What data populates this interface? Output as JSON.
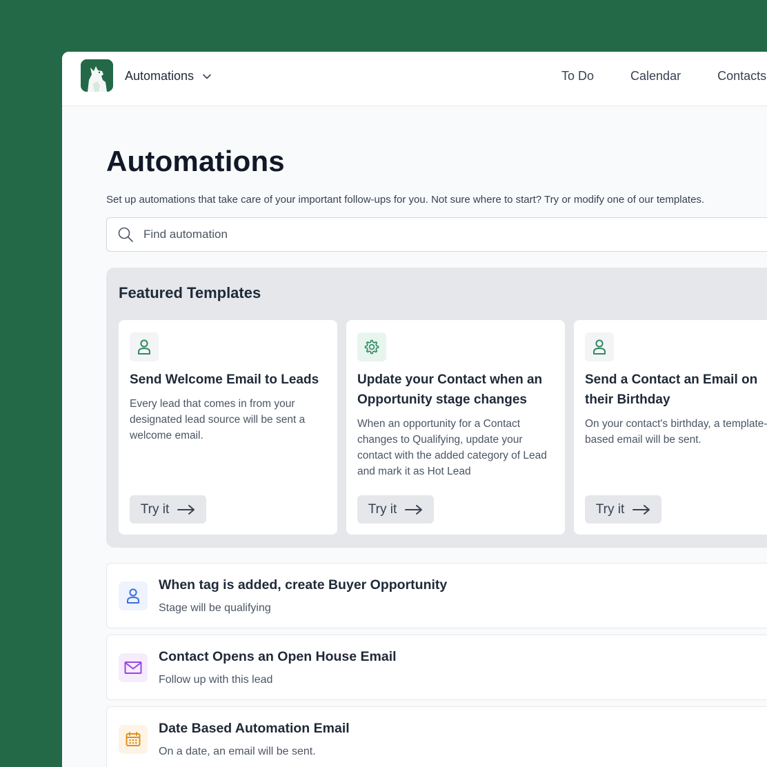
{
  "header": {
    "app_name": "Automations",
    "nav": [
      "To Do",
      "Calendar",
      "Contacts"
    ]
  },
  "page": {
    "title": "Automations",
    "subtitle": "Set up automations that take care of your important follow-ups for you. Not sure where to start? Try or modify one of our templates."
  },
  "search": {
    "placeholder": "Find automation",
    "value": ""
  },
  "featured": {
    "title": "Featured Templates",
    "cards": [
      {
        "icon": "user-icon",
        "title": "Send Welcome Email to Leads",
        "description": "Every lead that comes in from your designated lead source will be sent a welcome email.",
        "button": "Try it"
      },
      {
        "icon": "gear-icon",
        "title": "Update your Contact when an Opportunity stage changes",
        "description": "When an opportunity for a Contact changes to Qualifying, update your contact with the added category of Lead and mark it as Hot Lead",
        "button": "Try it"
      },
      {
        "icon": "user-icon",
        "title": "Send a Contact an Email on their Birthday",
        "description": "On your contact's birthday, a template-based email will be sent.",
        "button": "Try it"
      }
    ]
  },
  "automations": [
    {
      "icon": "user-icon",
      "title": "When tag is added, create Buyer Opportunity",
      "subtitle": "Stage will be qualifying"
    },
    {
      "icon": "envelope-icon",
      "title": "Contact Opens an Open House Email",
      "subtitle": "Follow up with this lead"
    },
    {
      "icon": "calendar-icon",
      "title": "Date Based Automation Email",
      "subtitle": "On a date, an email will be sent."
    }
  ],
  "colors": {
    "brand_green": "#236948",
    "teal_icon": "#2f8a62",
    "blue_icon": "#3b6fe0",
    "purple_icon": "#9b44e6",
    "amber_icon": "#e0911a"
  }
}
